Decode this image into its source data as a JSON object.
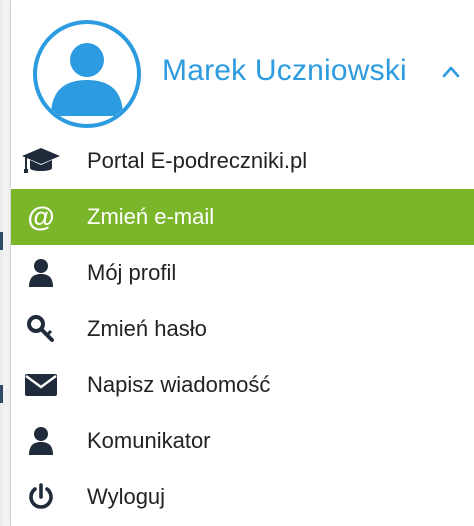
{
  "user_menu": {
    "user_name": "Marek Uczniowski",
    "avatar_icon": "user-avatar-icon",
    "toggle_icon": "chevron-up-icon",
    "accent_color": "#2c9be0",
    "active_color": "#7ab52a",
    "items": [
      {
        "label": "Portal E-podreczniki.pl",
        "icon": "graduation-cap-icon",
        "active": false
      },
      {
        "label": "Zmień e-mail",
        "icon": "at-sign-icon",
        "active": true
      },
      {
        "label": "Mój profil",
        "icon": "user-icon",
        "active": false
      },
      {
        "label": "Zmień hasło",
        "icon": "key-icon",
        "active": false
      },
      {
        "label": "Napisz wiadomość",
        "icon": "envelope-icon",
        "active": false
      },
      {
        "label": "Komunikator",
        "icon": "user-icon",
        "active": false
      },
      {
        "label": "Wyloguj",
        "icon": "power-icon",
        "active": false
      }
    ]
  }
}
